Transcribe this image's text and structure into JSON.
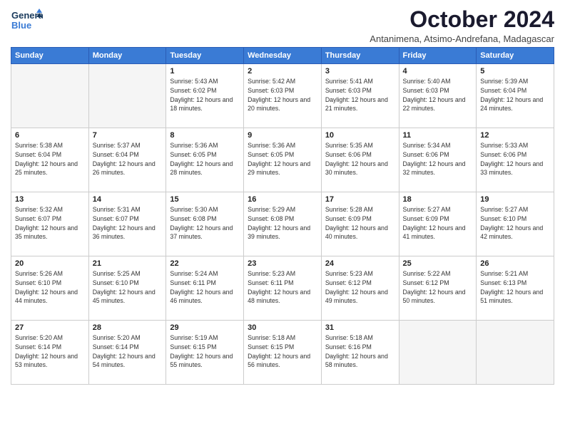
{
  "header": {
    "logo_line1": "General",
    "logo_line2": "Blue",
    "month_title": "October 2024",
    "subtitle": "Antanimena, Atsimo-Andrefana, Madagascar"
  },
  "weekdays": [
    "Sunday",
    "Monday",
    "Tuesday",
    "Wednesday",
    "Thursday",
    "Friday",
    "Saturday"
  ],
  "weeks": [
    [
      {
        "day": "",
        "sunrise": "",
        "sunset": "",
        "daylight": "",
        "empty": true
      },
      {
        "day": "",
        "sunrise": "",
        "sunset": "",
        "daylight": "",
        "empty": true
      },
      {
        "day": "1",
        "sunrise": "Sunrise: 5:43 AM",
        "sunset": "Sunset: 6:02 PM",
        "daylight": "Daylight: 12 hours and 18 minutes.",
        "empty": false
      },
      {
        "day": "2",
        "sunrise": "Sunrise: 5:42 AM",
        "sunset": "Sunset: 6:03 PM",
        "daylight": "Daylight: 12 hours and 20 minutes.",
        "empty": false
      },
      {
        "day": "3",
        "sunrise": "Sunrise: 5:41 AM",
        "sunset": "Sunset: 6:03 PM",
        "daylight": "Daylight: 12 hours and 21 minutes.",
        "empty": false
      },
      {
        "day": "4",
        "sunrise": "Sunrise: 5:40 AM",
        "sunset": "Sunset: 6:03 PM",
        "daylight": "Daylight: 12 hours and 22 minutes.",
        "empty": false
      },
      {
        "day": "5",
        "sunrise": "Sunrise: 5:39 AM",
        "sunset": "Sunset: 6:04 PM",
        "daylight": "Daylight: 12 hours and 24 minutes.",
        "empty": false
      }
    ],
    [
      {
        "day": "6",
        "sunrise": "Sunrise: 5:38 AM",
        "sunset": "Sunset: 6:04 PM",
        "daylight": "Daylight: 12 hours and 25 minutes.",
        "empty": false
      },
      {
        "day": "7",
        "sunrise": "Sunrise: 5:37 AM",
        "sunset": "Sunset: 6:04 PM",
        "daylight": "Daylight: 12 hours and 26 minutes.",
        "empty": false
      },
      {
        "day": "8",
        "sunrise": "Sunrise: 5:36 AM",
        "sunset": "Sunset: 6:05 PM",
        "daylight": "Daylight: 12 hours and 28 minutes.",
        "empty": false
      },
      {
        "day": "9",
        "sunrise": "Sunrise: 5:36 AM",
        "sunset": "Sunset: 6:05 PM",
        "daylight": "Daylight: 12 hours and 29 minutes.",
        "empty": false
      },
      {
        "day": "10",
        "sunrise": "Sunrise: 5:35 AM",
        "sunset": "Sunset: 6:06 PM",
        "daylight": "Daylight: 12 hours and 30 minutes.",
        "empty": false
      },
      {
        "day": "11",
        "sunrise": "Sunrise: 5:34 AM",
        "sunset": "Sunset: 6:06 PM",
        "daylight": "Daylight: 12 hours and 32 minutes.",
        "empty": false
      },
      {
        "day": "12",
        "sunrise": "Sunrise: 5:33 AM",
        "sunset": "Sunset: 6:06 PM",
        "daylight": "Daylight: 12 hours and 33 minutes.",
        "empty": false
      }
    ],
    [
      {
        "day": "13",
        "sunrise": "Sunrise: 5:32 AM",
        "sunset": "Sunset: 6:07 PM",
        "daylight": "Daylight: 12 hours and 35 minutes.",
        "empty": false
      },
      {
        "day": "14",
        "sunrise": "Sunrise: 5:31 AM",
        "sunset": "Sunset: 6:07 PM",
        "daylight": "Daylight: 12 hours and 36 minutes.",
        "empty": false
      },
      {
        "day": "15",
        "sunrise": "Sunrise: 5:30 AM",
        "sunset": "Sunset: 6:08 PM",
        "daylight": "Daylight: 12 hours and 37 minutes.",
        "empty": false
      },
      {
        "day": "16",
        "sunrise": "Sunrise: 5:29 AM",
        "sunset": "Sunset: 6:08 PM",
        "daylight": "Daylight: 12 hours and 39 minutes.",
        "empty": false
      },
      {
        "day": "17",
        "sunrise": "Sunrise: 5:28 AM",
        "sunset": "Sunset: 6:09 PM",
        "daylight": "Daylight: 12 hours and 40 minutes.",
        "empty": false
      },
      {
        "day": "18",
        "sunrise": "Sunrise: 5:27 AM",
        "sunset": "Sunset: 6:09 PM",
        "daylight": "Daylight: 12 hours and 41 minutes.",
        "empty": false
      },
      {
        "day": "19",
        "sunrise": "Sunrise: 5:27 AM",
        "sunset": "Sunset: 6:10 PM",
        "daylight": "Daylight: 12 hours and 42 minutes.",
        "empty": false
      }
    ],
    [
      {
        "day": "20",
        "sunrise": "Sunrise: 5:26 AM",
        "sunset": "Sunset: 6:10 PM",
        "daylight": "Daylight: 12 hours and 44 minutes.",
        "empty": false
      },
      {
        "day": "21",
        "sunrise": "Sunrise: 5:25 AM",
        "sunset": "Sunset: 6:10 PM",
        "daylight": "Daylight: 12 hours and 45 minutes.",
        "empty": false
      },
      {
        "day": "22",
        "sunrise": "Sunrise: 5:24 AM",
        "sunset": "Sunset: 6:11 PM",
        "daylight": "Daylight: 12 hours and 46 minutes.",
        "empty": false
      },
      {
        "day": "23",
        "sunrise": "Sunrise: 5:23 AM",
        "sunset": "Sunset: 6:11 PM",
        "daylight": "Daylight: 12 hours and 48 minutes.",
        "empty": false
      },
      {
        "day": "24",
        "sunrise": "Sunrise: 5:23 AM",
        "sunset": "Sunset: 6:12 PM",
        "daylight": "Daylight: 12 hours and 49 minutes.",
        "empty": false
      },
      {
        "day": "25",
        "sunrise": "Sunrise: 5:22 AM",
        "sunset": "Sunset: 6:12 PM",
        "daylight": "Daylight: 12 hours and 50 minutes.",
        "empty": false
      },
      {
        "day": "26",
        "sunrise": "Sunrise: 5:21 AM",
        "sunset": "Sunset: 6:13 PM",
        "daylight": "Daylight: 12 hours and 51 minutes.",
        "empty": false
      }
    ],
    [
      {
        "day": "27",
        "sunrise": "Sunrise: 5:20 AM",
        "sunset": "Sunset: 6:14 PM",
        "daylight": "Daylight: 12 hours and 53 minutes.",
        "empty": false
      },
      {
        "day": "28",
        "sunrise": "Sunrise: 5:20 AM",
        "sunset": "Sunset: 6:14 PM",
        "daylight": "Daylight: 12 hours and 54 minutes.",
        "empty": false
      },
      {
        "day": "29",
        "sunrise": "Sunrise: 5:19 AM",
        "sunset": "Sunset: 6:15 PM",
        "daylight": "Daylight: 12 hours and 55 minutes.",
        "empty": false
      },
      {
        "day": "30",
        "sunrise": "Sunrise: 5:18 AM",
        "sunset": "Sunset: 6:15 PM",
        "daylight": "Daylight: 12 hours and 56 minutes.",
        "empty": false
      },
      {
        "day": "31",
        "sunrise": "Sunrise: 5:18 AM",
        "sunset": "Sunset: 6:16 PM",
        "daylight": "Daylight: 12 hours and 58 minutes.",
        "empty": false
      },
      {
        "day": "",
        "sunrise": "",
        "sunset": "",
        "daylight": "",
        "empty": true
      },
      {
        "day": "",
        "sunrise": "",
        "sunset": "",
        "daylight": "",
        "empty": true
      }
    ]
  ]
}
